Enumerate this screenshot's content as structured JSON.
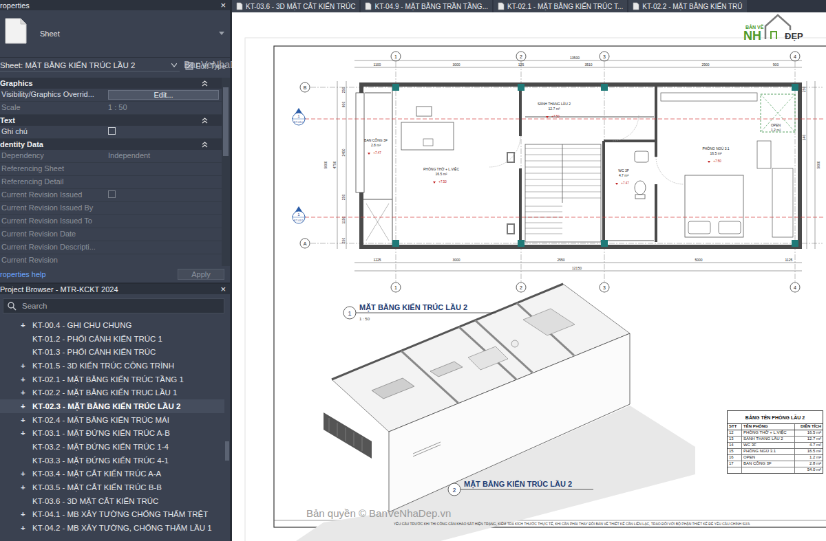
{
  "properties": {
    "title": "roperties",
    "close": "×",
    "type_name": "Sheet",
    "selector": "Sheet: MẶT BẰNG KIẾN TRÚC LẦU 2",
    "edit_type": "Edit Type",
    "sections": [
      {
        "title": "Graphics",
        "rows": [
          {
            "label": "Visibility/Graphics Overrid...",
            "value": "Edit...",
            "kind": "button",
            "disabled": false,
            "checked": false
          },
          {
            "label": "Scale",
            "value": "1 : 50",
            "kind": "text",
            "disabled": true,
            "checked": false
          }
        ]
      },
      {
        "title": "Text",
        "rows": [
          {
            "label": "Ghi chú",
            "value": "",
            "kind": "checkbox",
            "disabled": false,
            "checked": false
          }
        ]
      },
      {
        "title": "dentity Data",
        "rows": [
          {
            "label": "Dependency",
            "value": "Independent",
            "kind": "text",
            "disabled": true,
            "checked": false
          },
          {
            "label": "Referencing Sheet",
            "value": "",
            "kind": "text",
            "disabled": true,
            "checked": false
          },
          {
            "label": "Referencing Detail",
            "value": "",
            "kind": "text",
            "disabled": true,
            "checked": false
          },
          {
            "label": "Current Revision Issued",
            "value": "",
            "kind": "checkbox",
            "disabled": true,
            "checked": false
          },
          {
            "label": "Current Revision Issued By",
            "value": "",
            "kind": "text",
            "disabled": true,
            "checked": false
          },
          {
            "label": "Current Revision Issued To",
            "value": "",
            "kind": "text",
            "disabled": true,
            "checked": false
          },
          {
            "label": "Current Revision Date",
            "value": "",
            "kind": "text",
            "disabled": true,
            "checked": false
          },
          {
            "label": "Current Revision Descripti...",
            "value": "",
            "kind": "text",
            "disabled": true,
            "checked": false
          },
          {
            "label": "Current Revision",
            "value": "",
            "kind": "text",
            "disabled": true,
            "checked": false
          }
        ]
      }
    ],
    "help": "roperties help",
    "apply": "Apply"
  },
  "watermark_panel": "BanVeNhaDep.vn",
  "browser": {
    "title": "Project Browser - MTR-KCKT 2024",
    "close": "×",
    "search": "Search",
    "expand_glyph": "+",
    "items": [
      {
        "label": "KT-00.4 - GHI CHU CHUNG",
        "expandable": true,
        "selected": false
      },
      {
        "label": "KT-01.2 - PHỐI CẢNH KIẾN TRÚC 1",
        "expandable": false,
        "selected": false
      },
      {
        "label": "KT-01.3 - PHỐI CẢNH KIẾN TRÚC",
        "expandable": false,
        "selected": false
      },
      {
        "label": "KT-01.5 - 3D KIẾN TRÚC CÔNG TRÌNH",
        "expandable": true,
        "selected": false
      },
      {
        "label": "KT-02.1 - MẶT BẰNG KIẾN TRÚC TẦNG 1",
        "expandable": true,
        "selected": false
      },
      {
        "label": "KT-02.2 - MẶT BẰNG KIẾN TRUC LẦU 1",
        "expandable": true,
        "selected": false
      },
      {
        "label": "KT-02.3 - MẶT BẰNG KIẾN TRÚC LẦU 2",
        "expandable": true,
        "selected": true
      },
      {
        "label": "KT-02.4 - MẶT BẰNG KIẾN TRÚC MÁI",
        "expandable": true,
        "selected": false
      },
      {
        "label": "KT-03.1 - MẶT ĐỨNG KIẾN TRÚC A-B",
        "expandable": true,
        "selected": false
      },
      {
        "label": "KT-03.2 - MẶT ĐỨNG KIẾN TRÚC 1-4",
        "expandable": false,
        "selected": false
      },
      {
        "label": "KT-03.3 - MẶT ĐỨNG KIẾN TRÚC 4-1",
        "expandable": false,
        "selected": false
      },
      {
        "label": "KT-03.4 - MẶT CẮT KIẾN TRÚC A-A",
        "expandable": true,
        "selected": false
      },
      {
        "label": "KT-03.5 - MẶT CẮT KIẾN TRÚC B-B",
        "expandable": true,
        "selected": false
      },
      {
        "label": "KT-03.6 - 3D MẶT CẮT KIẾN TRÚC",
        "expandable": false,
        "selected": false
      },
      {
        "label": "KT-04.1 - MB XÂY TƯỜNG CHỐNG THẤM TRỆT",
        "expandable": true,
        "selected": false
      },
      {
        "label": "KT-04.2 - MB XÂY TƯỜNG, CHỐNG THẤM LẦU 1",
        "expandable": true,
        "selected": false
      }
    ]
  },
  "tabs": [
    {
      "label": "KT-03.6 - 3D MẶT CẮT KIẾN TRÚC",
      "selected": false
    },
    {
      "label": "KT-04.9 - MẶT BẰNG TRẦN TẦNG...",
      "selected": false
    },
    {
      "label": "KT-02.1 - MẶT BẰNG KIẾN TRÚC T...",
      "selected": false
    },
    {
      "label": "KT-02.2 - MẶT BẰNG KIẾN TRÚ",
      "selected": false
    }
  ],
  "sheet": {
    "logo": {
      "top": "BẢN VẼ",
      "left": "NH",
      "right": "ĐẸP"
    },
    "grid_columns": [
      "1",
      "2",
      "3",
      "4"
    ],
    "grid_rows": [
      "B",
      "A"
    ],
    "dims_top_overall": "13500",
    "dims_top": [
      "1100",
      "3000",
      "125",
      "3510",
      "2900",
      "900"
    ],
    "dims_bottom": [
      "1225",
      "3000",
      "2550",
      "5000",
      "1125"
    ],
    "dims_bottom_overall": "12150",
    "dims_left": [
      "250",
      "600",
      "2450",
      "250",
      "1150",
      "250"
    ],
    "dims_left_overall": "5000",
    "dims_left_mid": "4750",
    "dims_right": [
      "250",
      "140"
    ],
    "dims_right_overall": "5000",
    "rooms": [
      {
        "name": "BAN CÔNG 3F",
        "area": "2.8 m²",
        "level": "+7.47"
      },
      {
        "name": "PHÒNG THỜ + L.VIỆC",
        "area": "16.5 m²",
        "level": "+7.50"
      },
      {
        "name": "SẢNH THANG LẦU 2",
        "area": "12.7 m²",
        "level": "+7.50"
      },
      {
        "name": "WC 3F",
        "area": "4.7 m²",
        "level": "+7.47"
      },
      {
        "name": "PHÒNG NGỦ 3.1",
        "area": "16.5 m²",
        "level": "+7.50"
      },
      {
        "name": "OPEN",
        "area": "1.2 m²",
        "level": ""
      }
    ],
    "section_marks": [
      {
        "number": "1",
        "sheet": "KT-03.4"
      },
      {
        "number": "1",
        "sheet": "KT-03.5"
      }
    ],
    "views": [
      {
        "number": "1",
        "title": "MẶT BẰNG KIẾN TRÚC LẦU 2",
        "scale": "1 : 50"
      },
      {
        "number": "2",
        "title": "MẶT BẰNG KIẾN TRÚC LẦU 2",
        "scale": ""
      }
    ],
    "schedule": {
      "title": "BẢNG TÊN PHÒNG LẦU 2",
      "columns": [
        "STT",
        "TÊN PHÒNG",
        "DIỆN TÍCH"
      ],
      "rows": [
        {
          "stt": "12",
          "name": "PHÒNG THỜ + L.VIỆC",
          "area": "16.5 m²"
        },
        {
          "stt": "13",
          "name": "SẢNH THANG LẦU 2",
          "area": "12.7 m²"
        },
        {
          "stt": "14",
          "name": "WC 3F",
          "area": "4.7 m²"
        },
        {
          "stt": "15",
          "name": "PHÒNG NGỦ 3.1",
          "area": "16.5 m²"
        },
        {
          "stt": "16",
          "name": "OPEN",
          "area": "1.2 m²"
        },
        {
          "stt": "17",
          "name": "BAN CÔNG 3F",
          "area": "2.8 m²"
        }
      ],
      "total": "54.0 m²"
    },
    "note": "YÊU CẦU TRƯỚC KHI THI CÔNG CẦN KHẢO SÁT HIỆN TRẠNG, KIỂM TRA KÍCH THƯỚC THỰC TẾ, KHI CẦN PHẢI THAY ĐỔI BẢN VẼ THIẾT KẾ CẦN LIÊN LẠC, TRAO ĐỔI VỚI BỘ PHẬN THIẾT KẾ ĐỂ YÊU CẦU CHỈNH SỬA",
    "watermark": "Bản quyền © BanVeNhaDep.vn"
  }
}
